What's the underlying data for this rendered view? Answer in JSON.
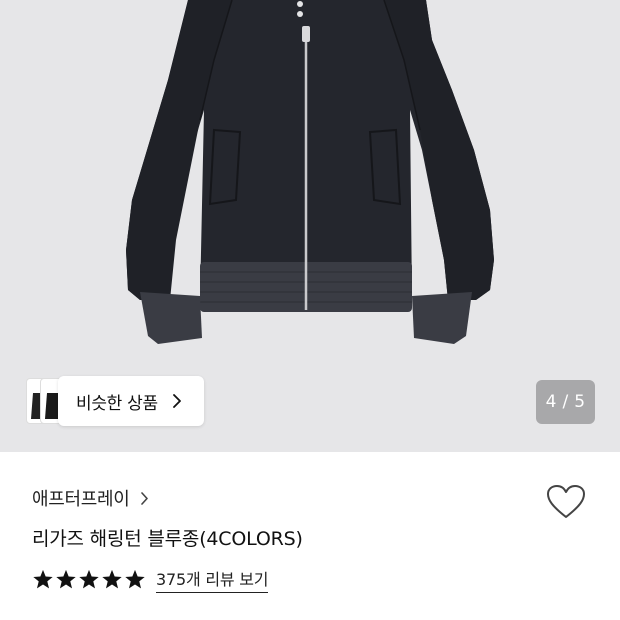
{
  "gallery": {
    "similar_button_label": "비슷한 상품",
    "page_counter": "4 / 5",
    "current_page": 4,
    "total_pages": 5
  },
  "product": {
    "brand": "애프터프레이",
    "title": "리가즈 해링턴 블루종(4COLORS)",
    "rating_stars": 5,
    "review_link": "375개 리뷰 보기"
  },
  "icons": {
    "chevron": "chevron-right-icon",
    "heart": "heart-outline-icon",
    "star": "star-filled-icon"
  },
  "colors": {
    "gallery_bg": "#e6e6e8",
    "jacket": "#24262d",
    "counter_bg": "#a8a8aa"
  }
}
